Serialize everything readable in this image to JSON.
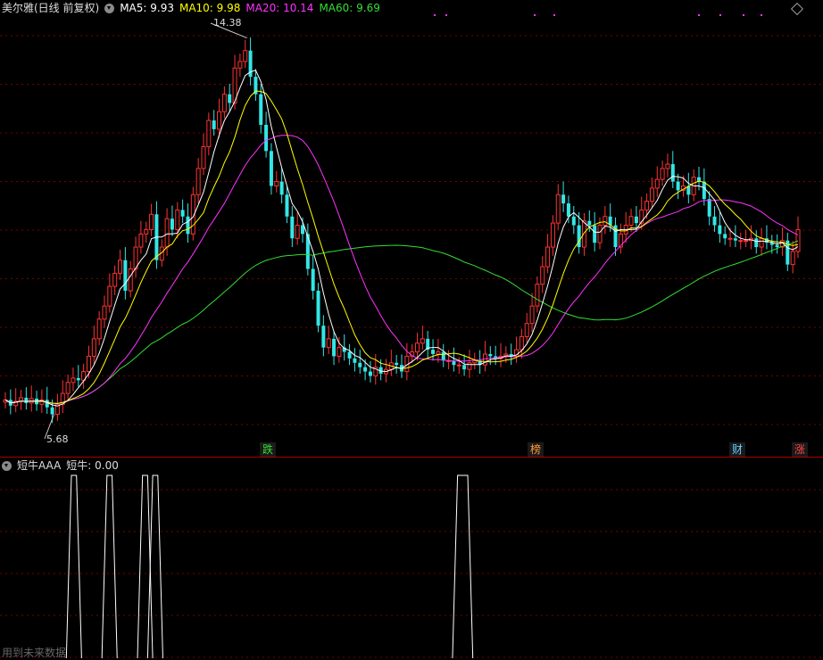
{
  "main_panel": {
    "title": "美尔雅(日线 前复权)",
    "indicators": [
      {
        "label": "MA5: 9.93",
        "color": "#ffffff"
      },
      {
        "label": "MA10: 9.98",
        "color": "#ffff00"
      },
      {
        "label": "MA20: 10.14",
        "color": "#ff33ff"
      },
      {
        "label": "MA60: 9.69",
        "color": "#33dd33"
      }
    ],
    "high_label": "14.38",
    "low_label": "5.68",
    "event_tags": [
      {
        "text": "跌",
        "color": "#33dd33"
      },
      {
        "text": "榜",
        "color": "#ff9933"
      },
      {
        "text": "财",
        "color": "#66ccff"
      },
      {
        "text": "涨",
        "color": "#ff4444"
      }
    ]
  },
  "sub_panel": {
    "title": "短牛AAA",
    "value_label": "短牛: 0.00"
  },
  "footer_text": "用到未来数据",
  "colors": {
    "up": "#ff3333",
    "down": "#33e6e6",
    "ma5": "#ffffff",
    "ma10": "#ffff00",
    "ma20": "#ff33ff",
    "ma60": "#33dd33",
    "grid": "#7a0000"
  },
  "chart_data": [
    {
      "type": "candlestick",
      "title": "美尔雅(日线 前复权)",
      "ylim": [
        5.2,
        14.8
      ],
      "high_marker": 14.38,
      "low_marker": 5.68,
      "close": [
        6.05,
        5.92,
        6.02,
        6.1,
        5.98,
        6.08,
        5.95,
        6.05,
        5.88,
        5.72,
        5.95,
        6.2,
        6.45,
        6.55,
        6.5,
        6.7,
        7.05,
        7.45,
        7.9,
        8.2,
        8.65,
        8.95,
        9.25,
        8.55,
        9.05,
        9.55,
        9.85,
        9.95,
        10.3,
        9.25,
        9.55,
        10.2,
        9.95,
        10.4,
        10.25,
        9.85,
        10.75,
        11.35,
        11.85,
        12.45,
        12.25,
        12.65,
        13.05,
        12.85,
        13.65,
        13.8,
        14.05,
        13.45,
        13.05,
        12.35,
        11.75,
        10.95,
        11.05,
        10.75,
        10.25,
        9.75,
        10.05,
        9.85,
        9.05,
        8.55,
        7.75,
        7.25,
        7.45,
        7.05,
        7.25,
        7.15,
        7.0,
        6.9,
        6.8,
        6.7,
        6.6,
        6.8,
        6.65,
        6.75,
        6.9,
        6.85,
        6.7,
        7.05,
        7.15,
        7.35,
        7.45,
        7.2,
        7.1,
        7.15,
        6.95,
        6.95,
        6.85,
        6.85,
        6.75,
        6.9,
        6.95,
        6.85,
        7.1,
        7.05,
        7.0,
        7.05,
        7.1,
        7.05,
        7.2,
        7.5,
        7.8,
        8.2,
        8.7,
        9.1,
        9.55,
        10.1,
        10.75,
        10.55,
        10.25,
        10.05,
        9.55,
        10.15,
        10.05,
        9.65,
        10.05,
        10.25,
        10.05,
        9.55,
        9.85,
        10.05,
        10.25,
        10.1,
        10.4,
        10.6,
        10.9,
        11.1,
        11.35,
        11.45,
        11.05,
        10.85,
        10.95,
        10.75,
        11.15,
        11.05,
        10.65,
        10.25,
        10.05,
        9.85,
        9.75,
        9.75,
        9.7,
        9.7,
        9.7,
        9.75,
        9.55,
        9.75,
        9.65,
        9.6,
        9.55,
        9.7,
        9.15,
        9.45,
        9.95
      ]
    },
    {
      "type": "line",
      "title": "短牛AAA",
      "series": [
        {
          "name": "短牛",
          "values": [
            0,
            0,
            0,
            0,
            0,
            0,
            0,
            0,
            0,
            0,
            0,
            0,
            0,
            0,
            0,
            0,
            0,
            0,
            0,
            0,
            0,
            0,
            0,
            0,
            0,
            0,
            0,
            0,
            0,
            1,
            1,
            0,
            0,
            0,
            0,
            0,
            0,
            0,
            0,
            0,
            0,
            0,
            0,
            0,
            0,
            0,
            0,
            0,
            0,
            0,
            0,
            0,
            0,
            0,
            0,
            0,
            0,
            0,
            0,
            0,
            0,
            0,
            0,
            0,
            0,
            0,
            0,
            0,
            0,
            0,
            0,
            0,
            0,
            0,
            0,
            0,
            0,
            0,
            0,
            0,
            0,
            0,
            0,
            0,
            0,
            0,
            0,
            0,
            0,
            0,
            0,
            0,
            0,
            0,
            0,
            0,
            0,
            0,
            0,
            0,
            0,
            0,
            0,
            0,
            0,
            0,
            0,
            0,
            0,
            0,
            0,
            0,
            0,
            0,
            0,
            0,
            0,
            0,
            0,
            0,
            0,
            0,
            0,
            0,
            0,
            0,
            0,
            0,
            0,
            0,
            0,
            0,
            0,
            0,
            0,
            0,
            0,
            0,
            0,
            0,
            0,
            0,
            0,
            0,
            0,
            0,
            0,
            0,
            0,
            0,
            0,
            0,
            0,
            0,
            0,
            0,
            0
          ]
        }
      ],
      "ylim": [
        0,
        1
      ]
    }
  ]
}
